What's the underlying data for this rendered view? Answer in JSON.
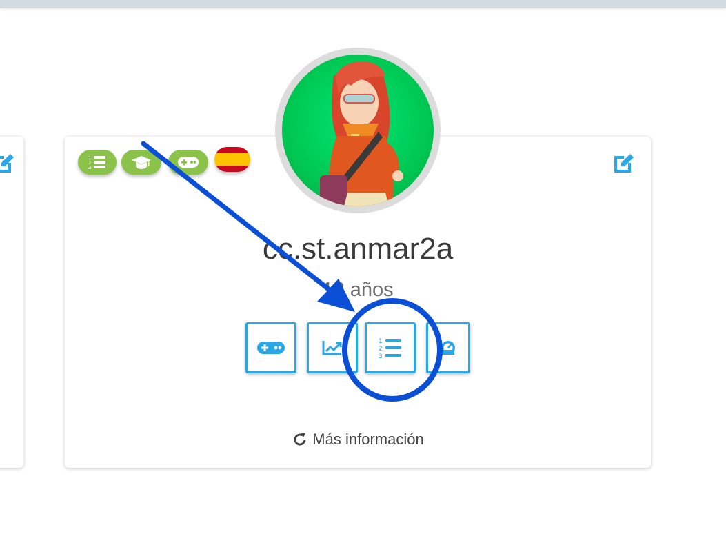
{
  "profile": {
    "username": "cc.st.anmar2a",
    "age": "18 años",
    "more_info": "Más información"
  },
  "badges": [
    {
      "icon": "ranking-list-icon"
    },
    {
      "icon": "graduation-cap-icon"
    },
    {
      "icon": "gamepad-icon"
    },
    {
      "icon": "spain-flag-icon"
    }
  ],
  "actions": [
    {
      "icon": "gamepad-icon"
    },
    {
      "icon": "chart-line-icon"
    },
    {
      "icon": "ranking-list-icon"
    },
    {
      "icon": "speedometer-icon"
    }
  ],
  "colors": {
    "accent": "#29a7e6",
    "badge_green": "#8bc34a",
    "annotation_blue": "#0a4fd6"
  }
}
